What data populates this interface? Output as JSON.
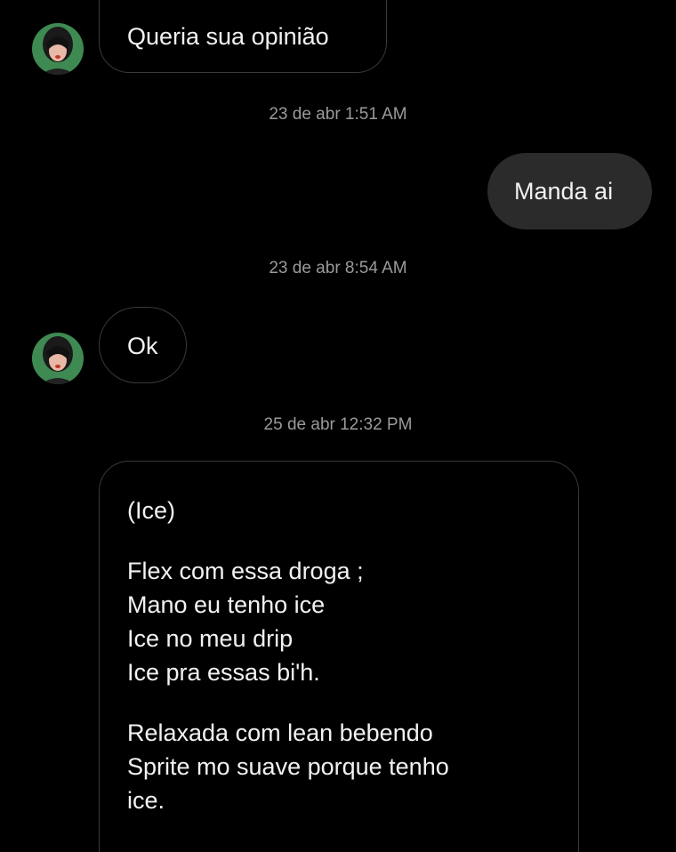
{
  "messages": {
    "m1": {
      "text": "Queria sua opinião"
    },
    "ts1": "23 de abr 1:51 AM",
    "m2": {
      "text": "Manda ai"
    },
    "ts2": "23 de abr 8:54 AM",
    "m3": {
      "text": "Ok"
    },
    "ts3": "25 de abr 12:32 PM",
    "m4": {
      "lines": [
        "(Ice)",
        "",
        "Flex com essa droga ;",
        "Mano eu tenho ice",
        "Ice no meu drip",
        "Ice pra essas bi'h.",
        "",
        "Relaxada com lean bebendo",
        "Sprite mo suave porque tenho",
        "ice."
      ]
    }
  },
  "colors": {
    "background": "#000000",
    "incoming_border": "#3a3a3a",
    "outgoing_bg": "#2b2b2b",
    "timestamp": "#9a9a9a",
    "avatar_ring": "#2c6a3f"
  },
  "icons": {
    "avatar": "contact-avatar-icon"
  }
}
